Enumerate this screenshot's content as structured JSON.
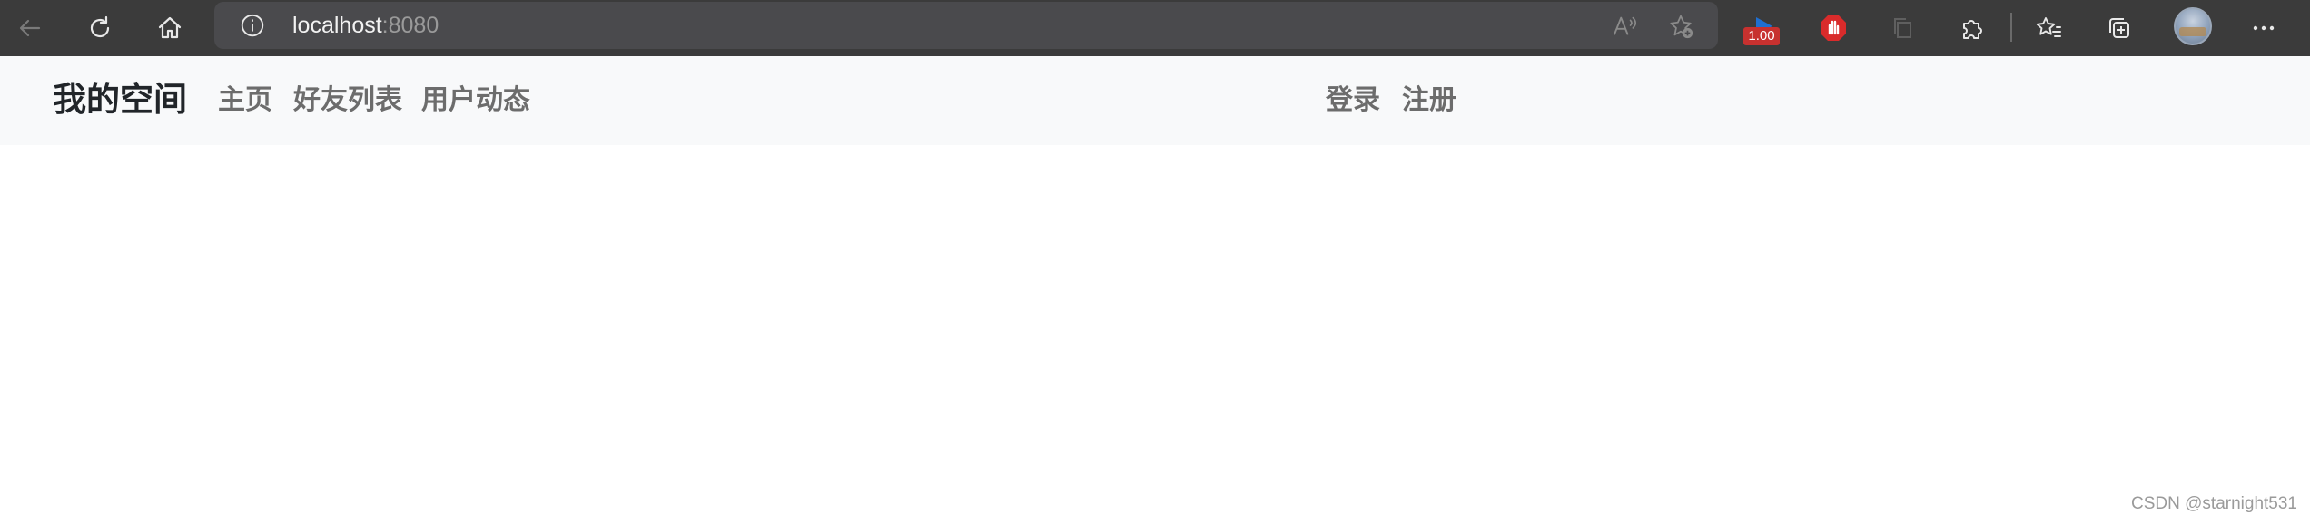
{
  "browser": {
    "url_host": "localhost",
    "url_port": ":8080",
    "extension_badge": "1.00",
    "icons": {
      "back": "arrow-left-icon",
      "reload": "reload-icon",
      "home": "home-icon",
      "site_info": "info-icon",
      "read_aloud": "read-aloud-icon",
      "add_favorite": "star-add-icon",
      "extension_media": "media-extension-icon",
      "extension_adblock": "stop-hand-icon",
      "extension_copy": "copy-icon",
      "extensions": "puzzle-icon",
      "favorites": "favorites-icon",
      "collections": "collections-icon",
      "profile": "avatar",
      "more": "more-icon"
    },
    "colors": {
      "toolbar_bg": "#3b3b3b",
      "address_bg": "#4a4a4d",
      "adblock_red": "#d92b2b"
    }
  },
  "navbar": {
    "brand": "我的空间",
    "links": {
      "home": "主页",
      "friends": "好友列表",
      "activity": "用户动态"
    },
    "auth": {
      "login": "登录",
      "register": "注册"
    },
    "colors": {
      "background": "#f8f9fa",
      "brand_text": "#212529",
      "link_text": "#6c6c6c"
    }
  },
  "watermark": "CSDN @starnight531"
}
